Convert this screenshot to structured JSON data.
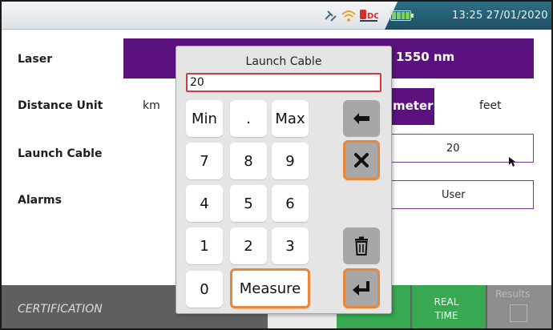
{
  "statusbar": {
    "clock": "13:25 27/01/2020",
    "icons": [
      "network-icon",
      "wifi-icon",
      "dc-power-icon",
      "battery-icon"
    ]
  },
  "settings": {
    "laser": {
      "label": "Laser",
      "value": "1550 nm"
    },
    "distance_unit": {
      "label": "Distance Unit",
      "options": [
        "km",
        "meter",
        "feet"
      ],
      "selected": "meter"
    },
    "launch_cable": {
      "label": "Launch Cable",
      "value": "20"
    },
    "alarms": {
      "label": "Alarms",
      "value": "User"
    }
  },
  "bottombar": {
    "certification": "CERTIFICATION",
    "realtime_line1": "REAL",
    "realtime_line2": "TIME",
    "results": "Results"
  },
  "keypad": {
    "title": "Launch Cable",
    "entry_value": "20",
    "keys": {
      "min": "Min",
      "dot": ".",
      "max": "Max",
      "k7": "7",
      "k8": "8",
      "k9": "9",
      "k4": "4",
      "k5": "5",
      "k6": "6",
      "k1": "1",
      "k2": "2",
      "k3": "3",
      "k0": "0",
      "measure": "Measure"
    }
  },
  "colors": {
    "accent_purple": "#5b127e",
    "highlight_orange": "#e8873a",
    "entry_border": "#d53939",
    "green_tab": "#39a852"
  }
}
